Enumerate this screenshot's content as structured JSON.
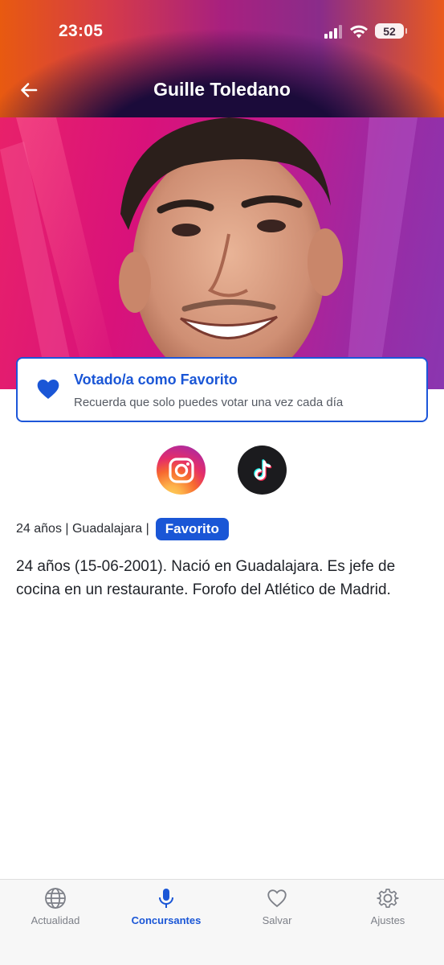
{
  "status_bar": {
    "time": "23:05",
    "battery": "52"
  },
  "header": {
    "title": "Guille Toledano"
  },
  "vote_card": {
    "title": "Votado/a como Favorito",
    "subtitle": "Recuerda que solo puedes votar una vez cada día",
    "accent_color": "#1a56d6"
  },
  "social": {
    "items": [
      {
        "name": "instagram",
        "icon": "instagram-icon"
      },
      {
        "name": "tiktok",
        "icon": "tiktok-icon"
      }
    ]
  },
  "profile": {
    "meta": "24 años | Guadalajara |",
    "badge": "Favorito",
    "bio": "24 años (15-06-2001). Nació en Guadalajara. Es jefe de cocina en un restaurante. Forofo del Atlético de Madrid."
  },
  "tabbar": {
    "items": [
      {
        "label": "Actualidad",
        "icon": "globe-icon",
        "active": false
      },
      {
        "label": "Concursantes",
        "icon": "microphone-icon",
        "active": true
      },
      {
        "label": "Salvar",
        "icon": "heart-icon",
        "active": false
      },
      {
        "label": "Ajustes",
        "icon": "gear-icon",
        "active": false
      }
    ]
  }
}
